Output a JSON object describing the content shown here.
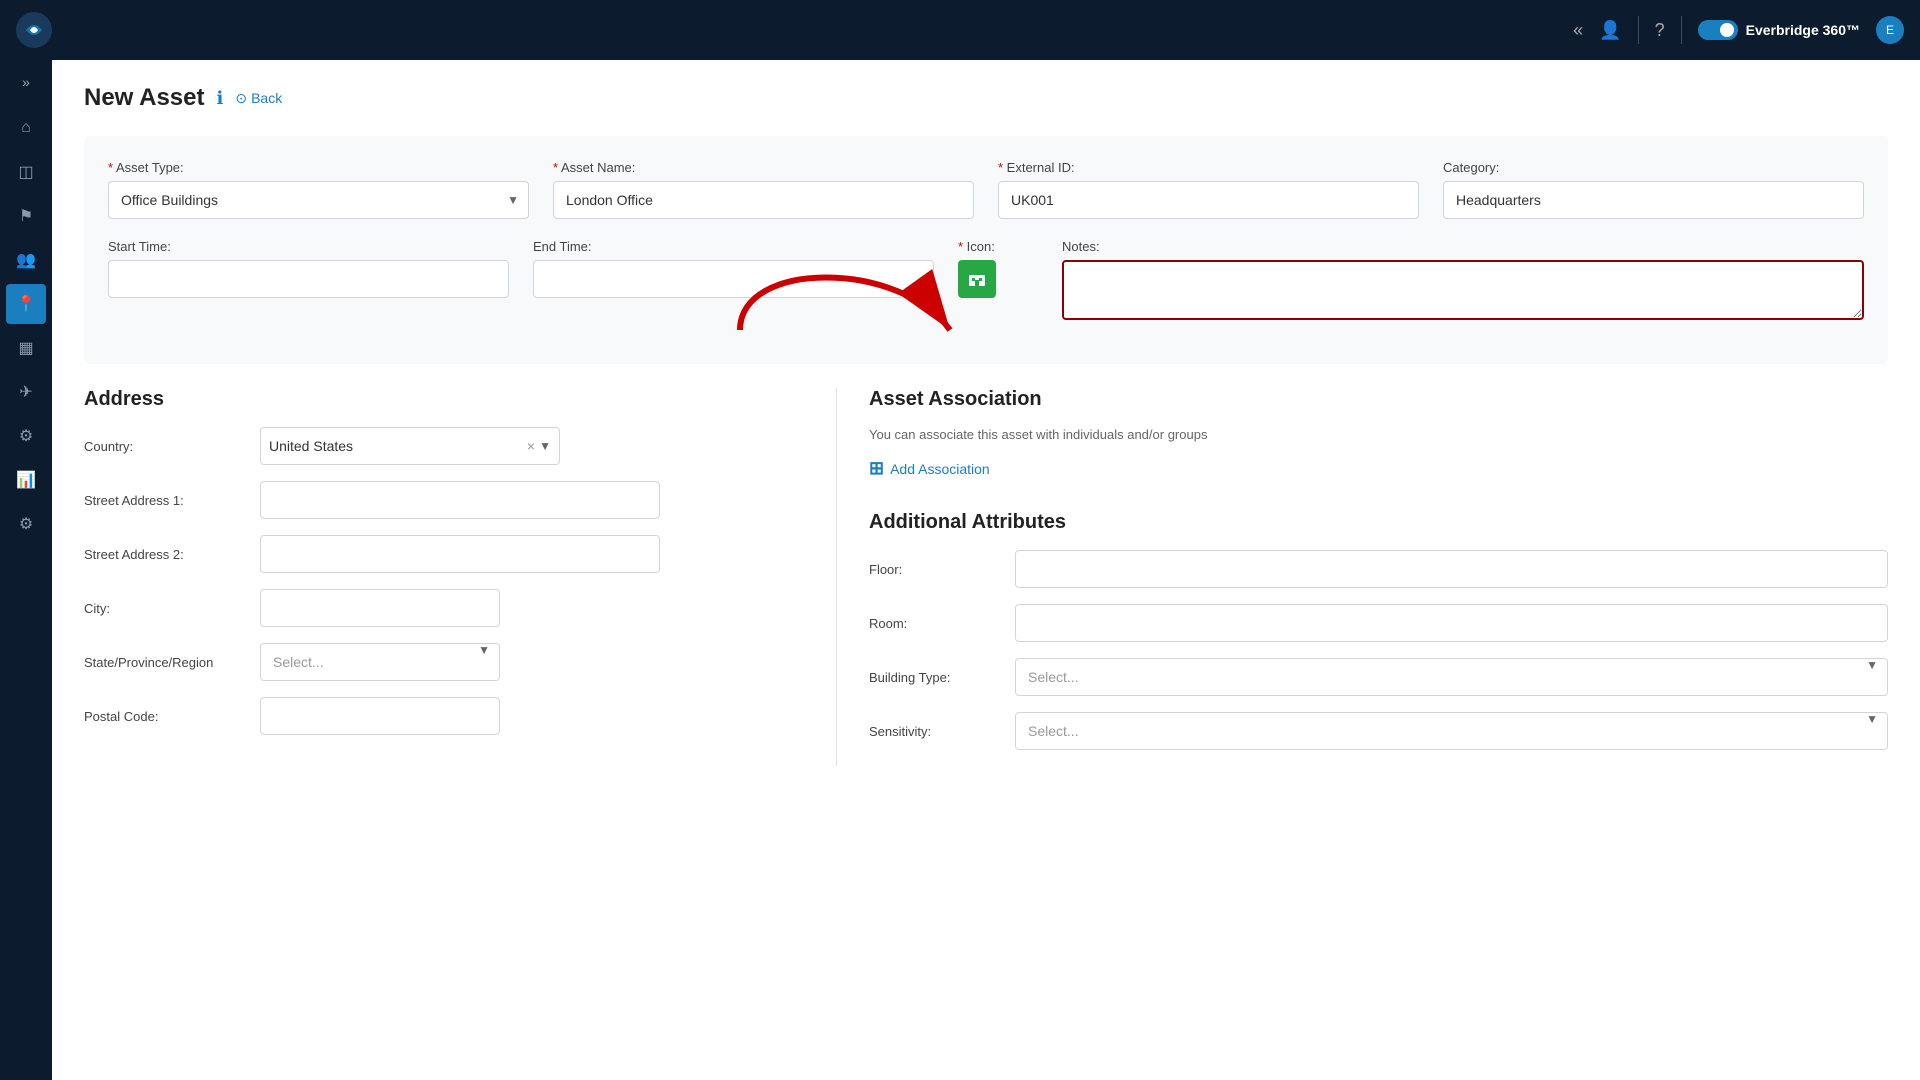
{
  "topNav": {
    "brandText": "Everbridge 360™",
    "chevronLeft": "«",
    "doubleCaret": "»"
  },
  "pageHeader": {
    "title": "New Asset",
    "backLabel": "Back"
  },
  "form": {
    "assetTypeLabel": "Asset Type:",
    "assetTypeValue": "Office Buildings",
    "assetNameLabel": "Asset Name:",
    "assetNameValue": "London Office",
    "externalIdLabel": "External ID:",
    "externalIdValue": "UK001",
    "categoryLabel": "Category:",
    "categoryValue": "Headquarters",
    "startTimeLabel": "Start Time:",
    "endTimeLabel": "End Time:",
    "iconLabel": "Icon:",
    "notesLabel": "Notes:"
  },
  "address": {
    "sectionTitle": "Address",
    "countryLabel": "Country:",
    "countryValue": "United States",
    "streetAddress1Label": "Street Address 1:",
    "streetAddress2Label": "Street Address 2:",
    "cityLabel": "City:",
    "stateLabel": "State/Province/Region",
    "statePlaceholder": "Select...",
    "postalCodeLabel": "Postal Code:"
  },
  "assetAssociation": {
    "title": "Asset Association",
    "subtitle": "You can associate this asset with individuals and/or groups",
    "addLabel": "Add Association"
  },
  "additionalAttributes": {
    "title": "Additional Attributes",
    "floorLabel": "Floor:",
    "roomLabel": "Room:",
    "buildingTypeLabel": "Building Type:",
    "buildingTypePlaceholder": "Select...",
    "sensitivityLabel": "Sensitivity:",
    "sensitivityPlaceholder": "Select..."
  },
  "sidebar": {
    "items": [
      {
        "icon": "⌂",
        "name": "home"
      },
      {
        "icon": "◫",
        "name": "dashboard"
      },
      {
        "icon": "⚑",
        "name": "alerts"
      },
      {
        "icon": "👥",
        "name": "contacts"
      },
      {
        "icon": "📍",
        "name": "assets"
      },
      {
        "icon": "▦",
        "name": "reports"
      },
      {
        "icon": "✈",
        "name": "travel"
      },
      {
        "icon": "⚙",
        "name": "integrations"
      },
      {
        "icon": "📊",
        "name": "analytics"
      },
      {
        "icon": "⚙",
        "name": "settings"
      }
    ]
  }
}
